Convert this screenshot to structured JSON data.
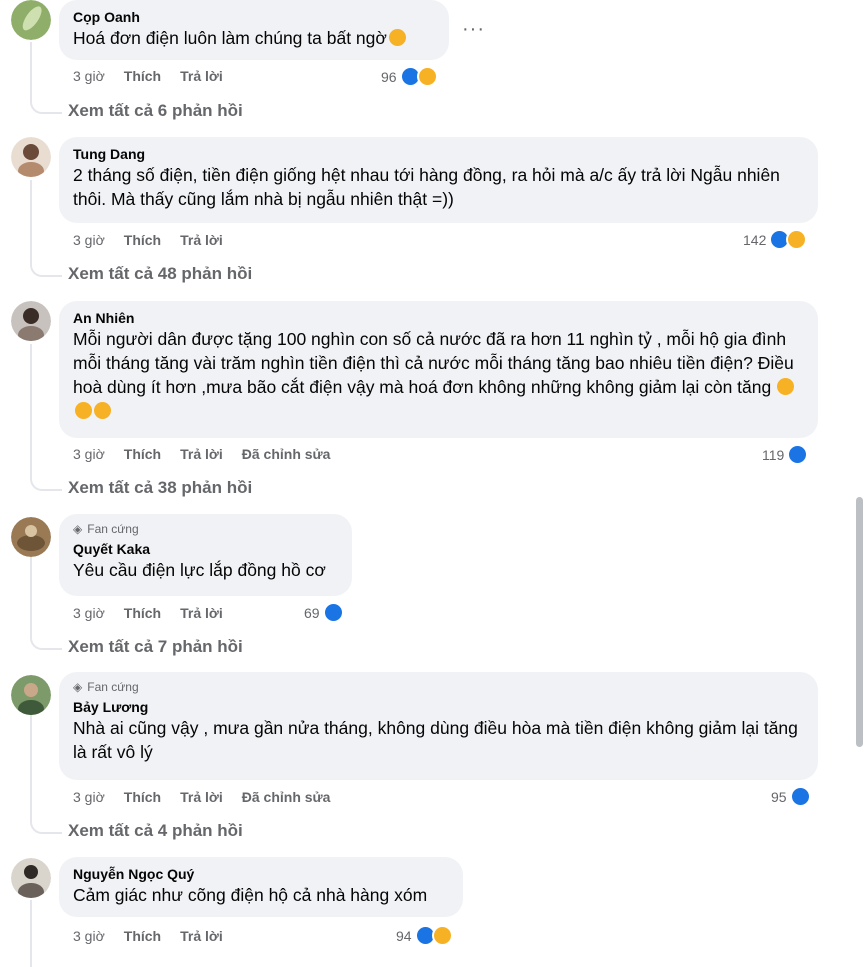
{
  "comments": [
    {
      "author": "Cọp Oanh",
      "badge": "",
      "text": "Hoá đơn điện luôn làm chúng ta bất ngờ",
      "time": "3 giờ",
      "like": "Thích",
      "reply": "Trả lời",
      "edited": "",
      "count": "96",
      "reactions": [
        "like-icon",
        "haha-icon"
      ],
      "view_replies": "Xem tất cả 6 phản hồi"
    },
    {
      "author": "Tung Dang",
      "badge": "",
      "text": "2 tháng số điện, tiền điện giống hệt nhau tới hàng đồng, ra hỏi mà a/c ấy trả lời Ngẫu nhiên thôi. Mà thấy cũng lắm nhà bị ngẫu nhiên thật =))",
      "time": "3 giờ",
      "like": "Thích",
      "reply": "Trả lời",
      "edited": "",
      "count": "142",
      "reactions": [
        "like-icon",
        "haha-icon"
      ],
      "view_replies": "Xem tất cả 48 phản hồi"
    },
    {
      "author": "An Nhiên",
      "badge": "",
      "text": "Mỗi người dân được tặng 100 nghìn con số cả nước đã ra hơn 11 nghìn tỷ , mỗi hộ gia đình mỗi tháng tăng vài trăm nghìn tiền điện thì cả nước mỗi tháng tăng bao nhiêu tiền điện? Điều hoà dùng ít hơn ,mưa bão cắt điện vậy mà hoá đơn không những không giảm lại còn tăng",
      "time": "3 giờ",
      "like": "Thích",
      "reply": "Trả lời",
      "edited": "Đã chỉnh sửa",
      "count": "119",
      "reactions": [
        "like-icon"
      ],
      "view_replies": "Xem tất cả 38 phản hồi"
    },
    {
      "author": "Quyết Kaka",
      "badge": "Fan cứng",
      "text": "Yêu cầu điện lực lắp đồng hồ cơ",
      "time": "3 giờ",
      "like": "Thích",
      "reply": "Trả lời",
      "edited": "",
      "count": "69",
      "reactions": [
        "like-icon"
      ],
      "view_replies": "Xem tất cả 7 phản hồi"
    },
    {
      "author": "Bảy Lương",
      "badge": "Fan cứng",
      "text": "Nhà ai cũng vậy , mưa gần nửa tháng, không dùng điều hòa mà tiền điện không giảm lại tăng là rất vô lý",
      "time": "3 giờ",
      "like": "Thích",
      "reply": "Trả lời",
      "edited": "Đã chỉnh sửa",
      "count": "95",
      "reactions": [
        "like-icon"
      ],
      "view_replies": "Xem tất cả 4 phản hồi"
    },
    {
      "author": "Nguyễn Ngọc Quý",
      "badge": "",
      "text": "Cảm giác như cõng điện hộ cả nhà hàng xóm",
      "time": "3 giờ",
      "like": "Thích",
      "reply": "Trả lời",
      "edited": "",
      "count": "94",
      "reactions": [
        "like-icon",
        "haha-icon"
      ],
      "view_replies": ""
    }
  ],
  "more_options_icon": "more-horizontal-icon",
  "colors": {
    "bubble": "#f0f2f5",
    "meta": "#65676b",
    "like": "#1b74e4",
    "haha": "#f7b125"
  }
}
